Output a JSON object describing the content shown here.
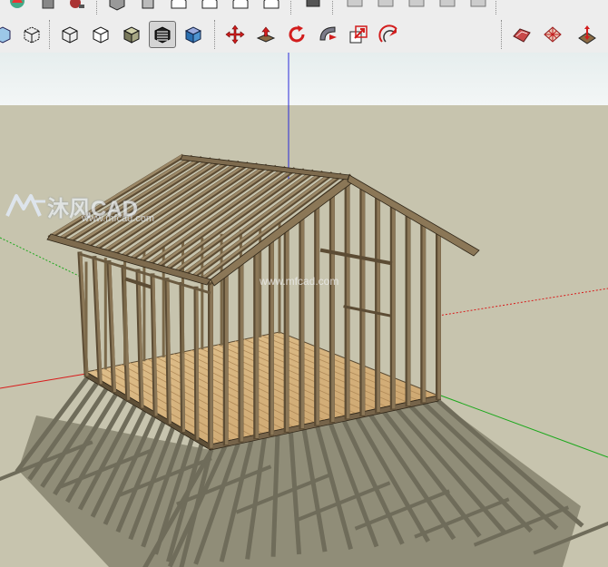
{
  "toolbar": {
    "row1_icons": [
      "orbit-tool-icon",
      "pan-tool-icon",
      "zoom-tool-icon",
      "iso-view-icon",
      "top-view-icon",
      "front-view-icon",
      "right-view-icon",
      "back-view-icon",
      "left-view-icon",
      "layer-icon",
      "section-icon"
    ],
    "row2_groups": {
      "face_style": [
        "xray-style-icon",
        "wireframe-style-icon",
        "hidden-line-style-icon",
        "shaded-style-icon",
        "shaded-textures-style-icon",
        "monochrome-style-icon"
      ],
      "edit": [
        "move-tool-icon",
        "push-pull-tool-icon",
        "rotate-tool-icon",
        "follow-me-tool-icon",
        "scale-tool-icon",
        "offset-tool-icon"
      ],
      "sandbox": [
        "sandbox-contours-icon",
        "sandbox-grid-icon",
        "sandbox-smoove-icon"
      ]
    },
    "active_style": "shaded-textures-style-icon"
  },
  "viewport": {
    "sky_color": "#eaf0f0",
    "ground_color": "#c7c4ae",
    "axis_colors": {
      "blue": "#2a2ad8",
      "red": "#d81c1c",
      "green": "#1ca81c"
    },
    "model": "house-frame",
    "watermarks": {
      "brand": "沐风CAD",
      "url_small": "www.mfcad.com",
      "url_center": "www.mfcad.com"
    }
  }
}
